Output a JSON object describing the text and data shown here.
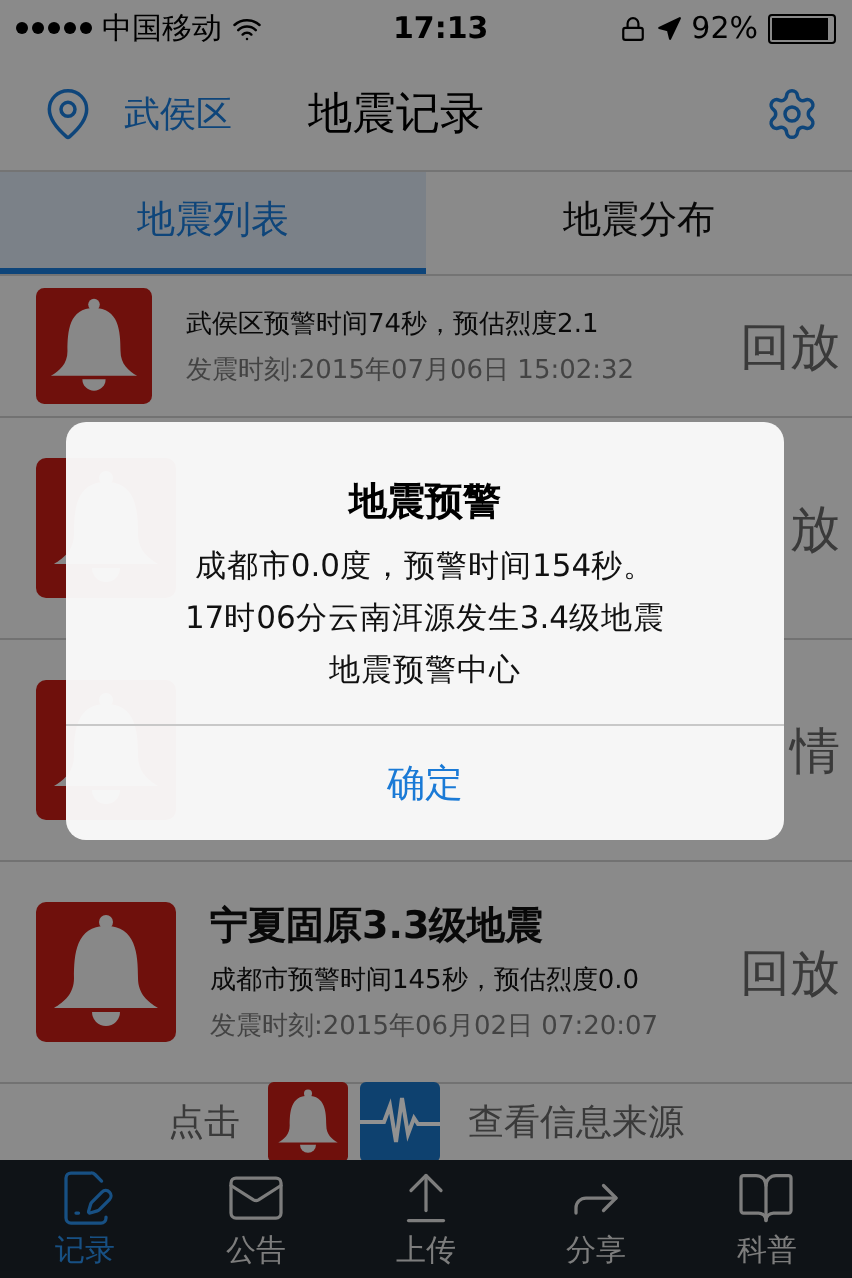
{
  "status_bar": {
    "carrier": "中国移动",
    "time": "17:13",
    "battery": "92%"
  },
  "nav": {
    "location": "武侯区",
    "title": "地震记录"
  },
  "tabs": [
    {
      "label": "地震列表",
      "selected": true
    },
    {
      "label": "地震分布",
      "selected": false
    }
  ],
  "rows": [
    {
      "subtitle": "武侯区预警时间74秒，预估烈度2.1",
      "time": "发震时刻:2015年07月06日 15:02:32",
      "action": "回放"
    },
    {
      "action": "放"
    },
    {
      "action": "情"
    },
    {
      "title": "宁夏固原3.3级地震",
      "subtitle": "成都市预警时间145秒，预估烈度0.0",
      "time": "发震时刻:2015年06月02日 07:20:07",
      "action": "回放"
    }
  ],
  "hint": {
    "before": "点击",
    "after": "查看信息来源"
  },
  "dialog": {
    "title": "地震预警",
    "lines": [
      "成都市0.0度，预警时间154秒。",
      "17时06分云南洱源发生3.4级地震",
      "地震预警中心"
    ],
    "button": "确定"
  },
  "bottom_tabs": [
    {
      "label": "记录",
      "selected": true
    },
    {
      "label": "公告",
      "selected": false
    },
    {
      "label": "上传",
      "selected": false
    },
    {
      "label": "分享",
      "selected": false
    },
    {
      "label": "科普",
      "selected": false
    }
  ]
}
